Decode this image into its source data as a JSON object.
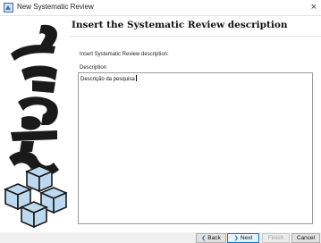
{
  "window": {
    "title": "New Systematic Review",
    "close": "×"
  },
  "page": {
    "heading": "Insert the Systematic Review description",
    "instruction": "Insert Systematic Review description:",
    "description_label": "Description",
    "description_value": "Descrição da pesquisa"
  },
  "buttons": {
    "back": "Back",
    "next": "Next",
    "finish": "Finish",
    "cancel": "Cancel",
    "back_arrow": "❮",
    "next_arrow": "❯"
  },
  "logo": {
    "text": "start",
    "icon": "start-logo"
  },
  "colors": {
    "accent": "#0078d7",
    "logo_dark": "#1a1a1a",
    "cube_fill": "#bcd9ef"
  }
}
